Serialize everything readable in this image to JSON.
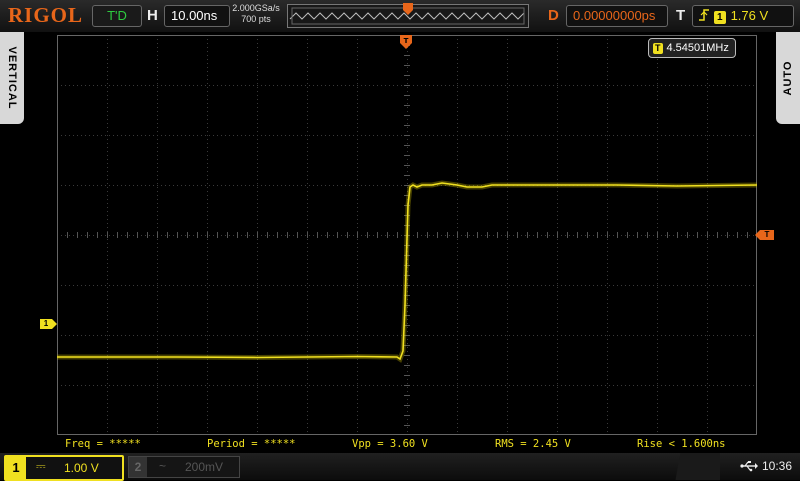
{
  "brand": {
    "logo": "RIGOL"
  },
  "status": {
    "run_state": "T'D"
  },
  "horizontal": {
    "label": "H",
    "timebase": "10.00ns"
  },
  "acquisition": {
    "sample_rate": "2.000GSa/s",
    "memory_depth": "700 pts"
  },
  "delay": {
    "label": "D",
    "value": "0.00000000ps"
  },
  "trigger": {
    "label": "T",
    "source": "1",
    "level": "1.76 V",
    "edge_icon": "rising-edge-icon"
  },
  "side_tabs": {
    "left": "VERTICAL",
    "right": "AUTO"
  },
  "frequency_counter": {
    "source": "T",
    "value": "4.54501MHz"
  },
  "measurements": [
    {
      "label": "Freq = *****"
    },
    {
      "label": "Period = *****"
    },
    {
      "label": "Vpp = 3.60 V"
    },
    {
      "label": "RMS = 2.45 V"
    },
    {
      "label": "Rise < 1.600ns"
    }
  ],
  "channels": [
    {
      "number": "1",
      "coupling": "⎓",
      "scale": "1.00 V",
      "active": true
    },
    {
      "number": "2",
      "coupling": "~",
      "scale": "200mV",
      "active": false
    }
  ],
  "markers": {
    "ch1": "1",
    "trigger_level": "T"
  },
  "clock": "10:36",
  "colors": {
    "ch1": "#f0e020",
    "trigger": "#e8661a",
    "run_state": "#2ecc40"
  }
}
